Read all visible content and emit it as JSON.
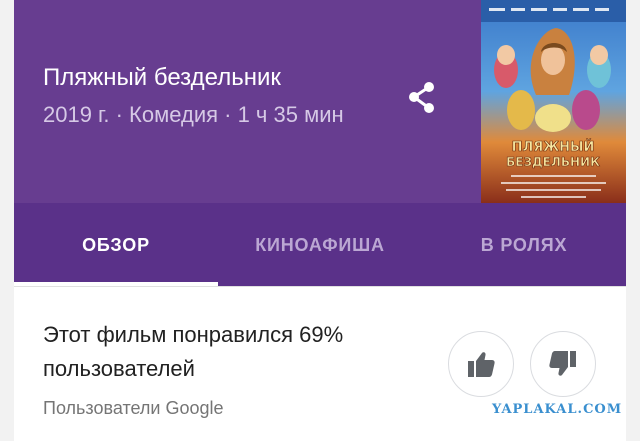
{
  "movie": {
    "title": "Пляжный бездельник",
    "meta": "2019 г. · Комедия · 1 ч 35 мин",
    "poster": {
      "title_line1": "ПЛЯЖНЫЙ",
      "title_line2": "БЕЗДЕЛЬНИК"
    }
  },
  "actions": {
    "share_icon": "share-icon"
  },
  "tabs": [
    {
      "label": "ОБЗОР",
      "active": true
    },
    {
      "label": "КИНОАФИША",
      "active": false
    },
    {
      "label": "В РОЛЯХ",
      "active": false
    }
  ],
  "rating": {
    "text": "Этот фильм понравился 69% пользователей",
    "percent_liked": 69,
    "source": "Пользователи Google",
    "like_icon": "thumbs-up-icon",
    "dislike_icon": "thumbs-down-icon"
  },
  "watermark": "YAPLAKAL.COM",
  "colors": {
    "header": "#673d90",
    "tab_bar": "#5a3189",
    "tab_active": "#ffffff",
    "tab_inactive": "#bba7d3"
  }
}
